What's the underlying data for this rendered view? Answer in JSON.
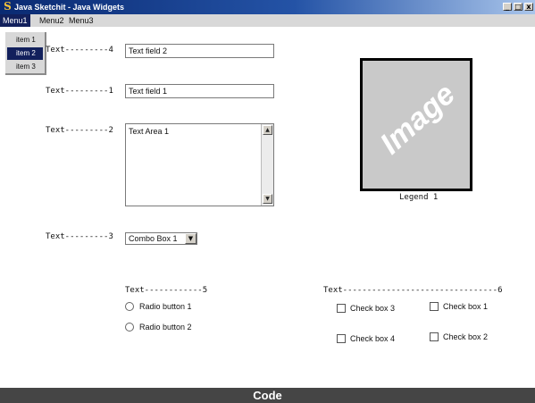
{
  "window": {
    "title": "Java Sketchit - Java Widgets",
    "app_icon": "S",
    "controls": {
      "minimize": "_",
      "maximize": "□",
      "close": "x"
    }
  },
  "menubar": {
    "items": [
      "Menu1",
      "Menu2",
      "Menu3"
    ],
    "active": "Menu1"
  },
  "dropdown": {
    "items": [
      "item 1",
      "item 2",
      "item 3"
    ],
    "selected": "item 2"
  },
  "labels": {
    "text4": "Text---------4",
    "text1": "Text---------1",
    "text2": "Text---------2",
    "text3": "Text---------3",
    "text5": "Text------------5",
    "text6": "Text--------------------------------6"
  },
  "fields": {
    "textfield2": "Text field 2",
    "textfield1": "Text field 1"
  },
  "textarea": {
    "value": "Text Area 1"
  },
  "combo": {
    "value": "Combo Box 1"
  },
  "image": {
    "word": "Image",
    "legend": "Legend 1",
    "background": "#c9c9c9"
  },
  "radios": [
    "Radio button 1",
    "Radio button 2"
  ],
  "checkboxes": {
    "cb3": "Check box 3",
    "cb1": "Check box 1",
    "cb4": "Check box 4",
    "cb2": "Check box 2"
  },
  "footer": {
    "label": "Code"
  },
  "colors": {
    "titlebar_start": "#0a2a72",
    "menu_highlight": "#12205c",
    "footer_bg": "#454545"
  }
}
